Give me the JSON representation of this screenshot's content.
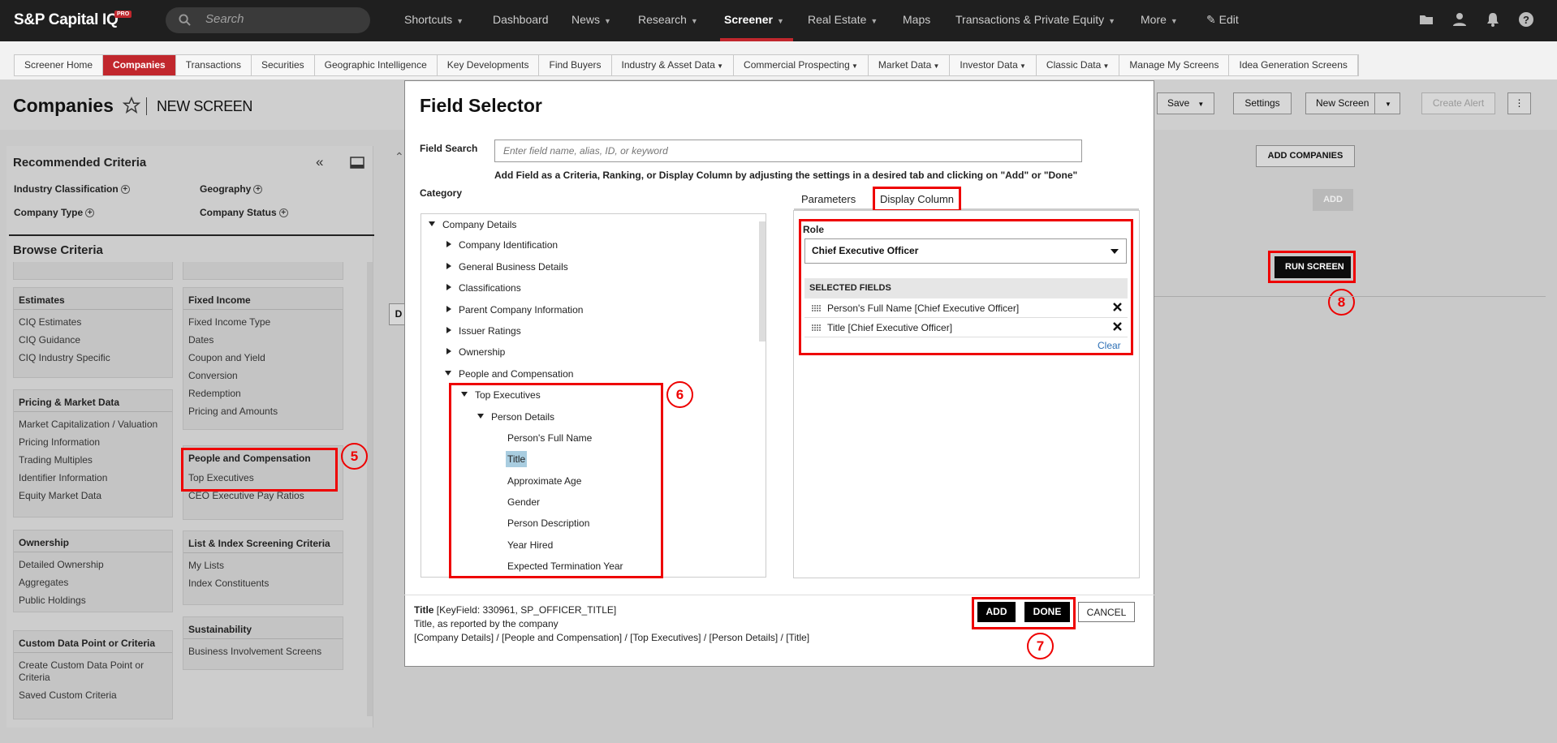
{
  "topnav": {
    "logo": "S&P Capital IQ",
    "logo_badge": "PRO",
    "search_placeholder": "Search",
    "items": [
      "Shortcuts",
      "Dashboard",
      "News",
      "Research",
      "Screener",
      "Real Estate",
      "Maps",
      "Transactions & Private Equity",
      "More",
      "Edit"
    ]
  },
  "subnav": {
    "tabs": [
      "Screener Home",
      "Companies",
      "Transactions",
      "Securities",
      "Geographic Intelligence",
      "Key Developments",
      "Find Buyers",
      "Industry & Asset Data",
      "Commercial Prospecting",
      "Market Data",
      "Investor Data",
      "Classic Data",
      "Manage My Screens",
      "Idea Generation Screens"
    ]
  },
  "page": {
    "title": "Companies",
    "screen_name": "NEW SCREEN",
    "buttons": {
      "save": "Save",
      "settings": "Settings",
      "new_screen": "New Screen",
      "create_alert": "Create Alert",
      "add_companies": "ADD COMPANIES",
      "add": "ADD",
      "run_screen": "RUN SCREEN"
    },
    "partial_letters": "D"
  },
  "sidebar": {
    "recommended_title": "Recommended Criteria",
    "recommended": [
      "Industry Classification",
      "Geography",
      "Company Type",
      "Company Status"
    ],
    "browse_title": "Browse Criteria",
    "cards": {
      "estimates": {
        "title": "Estimates",
        "items": [
          "CIQ Estimates",
          "CIQ Guidance",
          "CIQ Industry Specific"
        ]
      },
      "fixed_income": {
        "title": "Fixed Income",
        "items": [
          "Fixed Income Type",
          "Dates",
          "Coupon and Yield",
          "Conversion",
          "Redemption",
          "Pricing and Amounts"
        ]
      },
      "pricing": {
        "title": "Pricing & Market Data",
        "items": [
          "Market Capitalization / Valuation",
          "Pricing Information",
          "Trading Multiples",
          "Identifier Information",
          "Equity Market Data"
        ]
      },
      "people": {
        "title": "People and Compensation",
        "items": [
          "Top Executives",
          "CEO Executive Pay Ratios"
        ]
      },
      "ownership": {
        "title": "Ownership",
        "items": [
          "Detailed Ownership",
          "Aggregates",
          "Public Holdings"
        ]
      },
      "list_index": {
        "title": "List & Index Screening Criteria",
        "items": [
          "My Lists",
          "Index Constituents"
        ]
      },
      "sustainability": {
        "title": "Sustainability",
        "items": [
          "Business Involvement Screens"
        ]
      },
      "custom": {
        "title": "Custom Data Point or Criteria",
        "items": [
          "Create Custom Data Point or Criteria",
          "Saved Custom Criteria"
        ]
      }
    }
  },
  "modal": {
    "title": "Field Selector",
    "search_label": "Field Search",
    "search_placeholder": "Enter field name, alias, ID, or keyword",
    "help_text": "Add Field as a Criteria, Ranking, or Display Column by adjusting the settings in a desired tab and clicking on \"Add\" or \"Done\"",
    "category_label": "Category",
    "tree": [
      "Company Details",
      "Company Identification",
      "General Business Details",
      "Classifications",
      "Parent Company Information",
      "Issuer Ratings",
      "Ownership",
      "People and Compensation",
      "Top Executives",
      "Person Details",
      "Person's Full Name",
      "Title",
      "Approximate Age",
      "Gender",
      "Person Description",
      "Year Hired",
      "Expected Termination Year"
    ],
    "tabs": {
      "parameters": "Parameters",
      "display_column": "Display Column"
    },
    "role_label": "Role",
    "role_value": "Chief Executive Officer",
    "selected_header": "SELECTED FIELDS",
    "selected_fields": [
      "Person's Full Name [Chief Executive Officer]",
      "Title [Chief Executive Officer]"
    ],
    "clear": "Clear",
    "info": {
      "name": "Title",
      "keyfield": "[KeyField: 330961, SP_OFFICER_TITLE]",
      "description": "Title, as reported by the company",
      "path": "[Company Details] / [People and Compensation] / [Top Executives] / [Person Details] / [Title]"
    },
    "buttons": {
      "add": "ADD",
      "done": "DONE",
      "cancel": "CANCEL"
    }
  },
  "callouts": [
    "5",
    "6",
    "7",
    "8"
  ],
  "colors": {
    "accent": "#c1272d",
    "annotation": "#ee0000",
    "selection": "#a9cde0",
    "link": "#2c6fb5"
  }
}
